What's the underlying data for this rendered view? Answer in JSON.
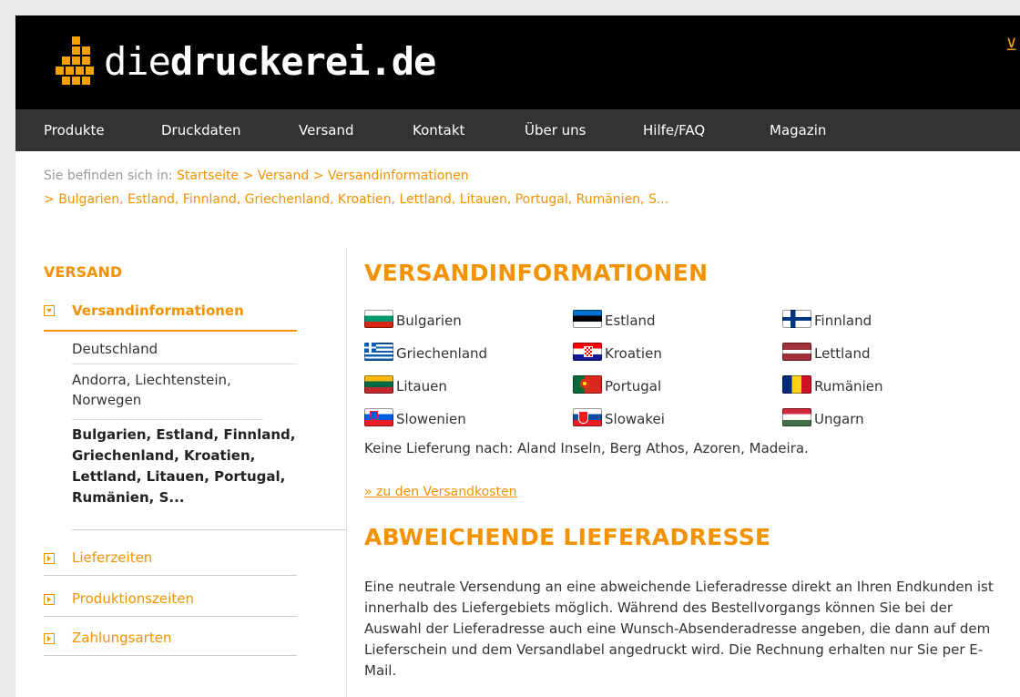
{
  "logo": {
    "text_light": "die",
    "text_bold": "druckerei",
    "text_tld": ".de"
  },
  "nav": [
    "Produkte",
    "Druckdaten",
    "Versand",
    "Kontakt",
    "Über uns",
    "Hilfe/FAQ",
    "Magazin"
  ],
  "breadcrumb": {
    "prefix": "Sie befinden sich in:",
    "items": [
      "Startseite",
      "Versand",
      "Versandinformationen"
    ],
    "current": "Bulgarien, Estland, Finnland, Griechenland, Kroatien, Lettland, Litauen, Portugal, Rumänien, S...",
    "separator": ">"
  },
  "sidebar": {
    "title": "VERSAND",
    "active_item": "Versandinformationen",
    "subitems": [
      "Deutschland",
      "Andorra, Liechtenstein, Norwegen",
      "Bulgarien, Estland, Finnland, Griechenland, Kroatien, Lettland, Litauen, Portugal, Rumänien, S..."
    ],
    "items": [
      "Lieferzeiten",
      "Produktionszeiten",
      "Zahlungsarten"
    ]
  },
  "main": {
    "heading": "VERSANDINFORMATIONEN",
    "countries": [
      {
        "name": "Bulgarien",
        "flag": "bulgaria-flag-icon"
      },
      {
        "name": "Estland",
        "flag": "estonia-flag-icon"
      },
      {
        "name": "Finnland",
        "flag": "finland-flag-icon"
      },
      {
        "name": "Griechenland",
        "flag": "greece-flag-icon"
      },
      {
        "name": "Kroatien",
        "flag": "croatia-flag-icon"
      },
      {
        "name": "Lettland",
        "flag": "latvia-flag-icon"
      },
      {
        "name": "Litauen",
        "flag": "lithuania-flag-icon"
      },
      {
        "name": "Portugal",
        "flag": "portugal-flag-icon"
      },
      {
        "name": "Rumänien",
        "flag": "romania-flag-icon"
      },
      {
        "name": "Slowenien",
        "flag": "slovenia-flag-icon"
      },
      {
        "name": "Slowakei",
        "flag": "slovakia-flag-icon"
      },
      {
        "name": "Ungarn",
        "flag": "hungary-flag-icon"
      }
    ],
    "no_delivery": "Keine Lieferung nach: Aland Inseln, Berg Athos, Azoren, Madeira.",
    "costs_link": "» zu den Versandkosten",
    "heading2": "ABWEICHENDE LIEFERADRESSE",
    "paragraph": "Eine neutrale Versendung an eine abweichende Lieferadresse direkt an Ihren Endkunden ist innerhalb des Liefergebiets möglich. Während des Bestellvorgangs können Sie bei der Auswahl der Lieferadresse auch eine Wunsch-Absenderadresse angeben, die dann auf dem Lieferschein und dem Versandlabel angedruckt wird. Die Rechnung erhalten nur Sie per E-Mail."
  },
  "colors": {
    "accent": "#f39200",
    "header_bg": "#000000",
    "nav_bg": "#333333"
  }
}
